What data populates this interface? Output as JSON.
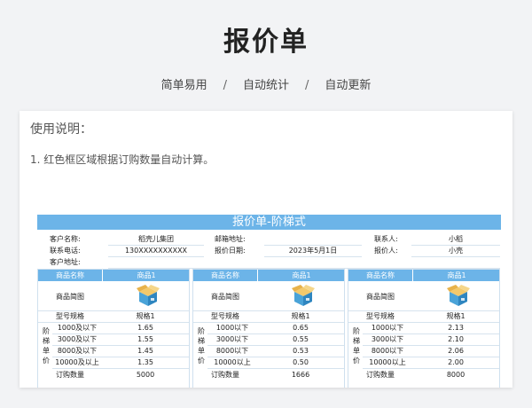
{
  "hero": {
    "title": "报价单"
  },
  "subtitle": {
    "items": [
      "简单易用",
      "自动统计",
      "自动更新"
    ],
    "separator": "/"
  },
  "usage": {
    "title": "使用说明：",
    "item1": "1. 红色框区域根据订购数量自动计算。"
  },
  "sheet": {
    "banner": "报价单-阶梯式",
    "info": {
      "customer_name_label": "客户名称:",
      "customer_name": "稻壳儿集团",
      "email_label": "邮箱地址:",
      "email": "",
      "contact_label": "联系人:",
      "contact": "小稻",
      "phone_label": "联系电话:",
      "phone": "130XXXXXXXXXX",
      "date_label": "报价日期:",
      "date": "2023年5月1日",
      "quoter_label": "报价人:",
      "quoter": "小壳",
      "address_label": "客户地址:",
      "address": ""
    },
    "products": [
      {
        "name_label": "商品名称",
        "name": "商品1",
        "image_label": "商品简图",
        "model_label": "型号规格",
        "model": "规格1",
        "tier_label": "阶梯单价",
        "tiers": [
          {
            "q": "1000及以下",
            "p": "1.65"
          },
          {
            "q": "3000及以下",
            "p": "1.55"
          },
          {
            "q": "8000及以下",
            "p": "1.45"
          },
          {
            "q": "10000及以上",
            "p": "1.35"
          }
        ],
        "qty_label": "订购数量",
        "qty": "5000"
      },
      {
        "name_label": "商品名称",
        "name": "商品1",
        "image_label": "商品简图",
        "model_label": "型号规格",
        "model": "规格1",
        "tier_label": "阶梯单价",
        "tiers": [
          {
            "q": "1000以下",
            "p": "0.65"
          },
          {
            "q": "3000以下",
            "p": "0.55"
          },
          {
            "q": "8000以下",
            "p": "0.53"
          },
          {
            "q": "10000以上",
            "p": "0.50"
          }
        ],
        "qty_label": "订购数量",
        "qty": "1666"
      },
      {
        "name_label": "商品名称",
        "name": "商品1",
        "image_label": "商品简图",
        "model_label": "型号规格",
        "model": "规格1",
        "tier_label": "阶梯单价",
        "tiers": [
          {
            "q": "1000以下",
            "p": "2.13"
          },
          {
            "q": "3000以下",
            "p": "2.10"
          },
          {
            "q": "8000以下",
            "p": "2.06"
          },
          {
            "q": "10000以上",
            "p": "2.00"
          }
        ],
        "qty_label": "订购数量",
        "qty": "8000"
      }
    ]
  }
}
